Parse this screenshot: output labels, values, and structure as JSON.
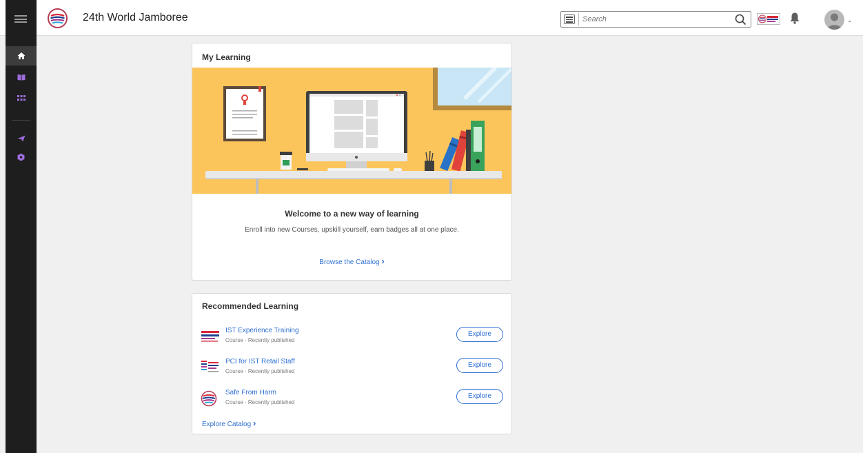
{
  "header": {
    "app_title": "24th World Jamboree",
    "search_placeholder": "Search",
    "icons": {
      "menu": "hamburger-icon",
      "search_menu": "list-icon",
      "search": "search-icon",
      "notifications": "bell-icon",
      "user": "avatar-icon"
    }
  },
  "sidebar": {
    "items": [
      {
        "icon": "home-icon",
        "active": true
      },
      {
        "icon": "book-icon",
        "active": false
      },
      {
        "icon": "grid-icon",
        "active": false
      },
      {
        "icon": "paper-plane-icon",
        "active": false
      },
      {
        "icon": "badge-icon",
        "active": false
      }
    ],
    "accent_color": "#9d6ddb"
  },
  "my_learning": {
    "title": "My Learning",
    "welcome_title": "Welcome to a new way of learning",
    "welcome_subtitle": "Enroll into new Courses, upskill yourself, earn badges all at one place.",
    "browse_link": "Browse the Catalog",
    "browse_chevron": "›",
    "hero_bg": "#fcc55c"
  },
  "recommended": {
    "title": "Recommended Learning",
    "courses": [
      {
        "name": "IST Experience Training",
        "meta": "Course · Recently published",
        "button": "Explore"
      },
      {
        "name": "PCI for IST Retail Staff",
        "meta": "Course · Recently published",
        "button": "Explore"
      },
      {
        "name": "Safe From Harm",
        "meta": "Course · Recently published",
        "button": "Explore"
      }
    ],
    "explore_catalog": "Explore Catalog",
    "explore_chevron": "›"
  },
  "colors": {
    "link": "#2d6fd2",
    "nav_bg": "#1e1e1e"
  }
}
